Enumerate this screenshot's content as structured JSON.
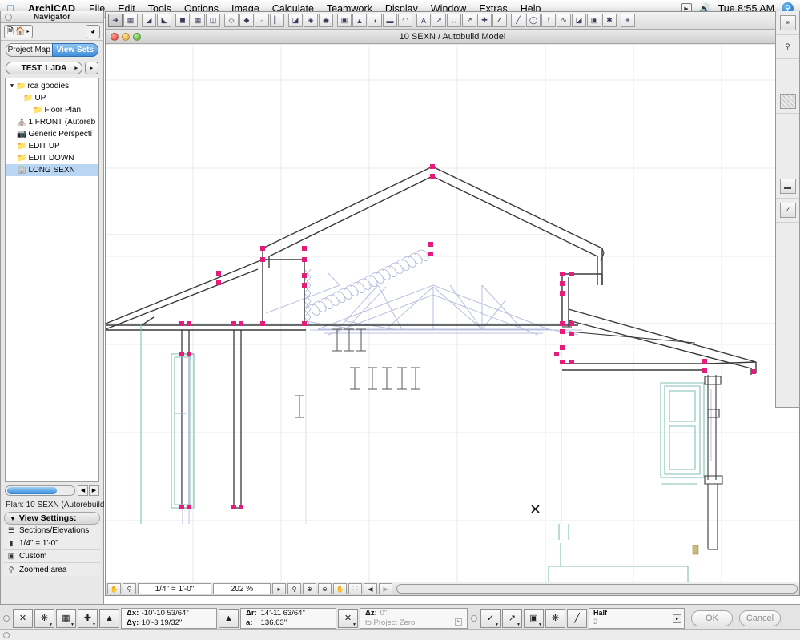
{
  "menubar": {
    "apple_icon": "apple-logo",
    "app_name": "ArchiCAD",
    "items": [
      "File",
      "Edit",
      "Tools",
      "Options",
      "Image",
      "Calculate",
      "Teamwork",
      "Display",
      "Window",
      "Extras",
      "Help"
    ],
    "status_icons": [
      "display-chevron-icon",
      "volume-icon"
    ],
    "clock": "Tue 8:55 AM",
    "spotlight_glyph": "search-icon"
  },
  "navigator": {
    "title": "Navigator",
    "toolbar": {
      "map_button": "project-map-button",
      "arrow": "▸",
      "right_button": "navigator-options-button"
    },
    "tabs": [
      {
        "label": "Project Map",
        "active": false
      },
      {
        "label": "View Sets",
        "active": true
      }
    ],
    "popup": {
      "value": "TEST 1 JDA",
      "arrow": "▸",
      "side_arrow": "▸"
    },
    "tree": [
      {
        "label": "rca goodies",
        "indent": 0,
        "twisty": "▼",
        "icon": "folder-icon",
        "selected": false
      },
      {
        "label": "UP",
        "indent": 1,
        "twisty": "",
        "icon": "folder-icon",
        "selected": false
      },
      {
        "label": "Floor Plan",
        "indent": 2,
        "twisty": "",
        "icon": "folder-icon",
        "selected": false
      },
      {
        "label": "1 FRONT (Autoreb",
        "indent": 0,
        "twisty": "",
        "icon": "elevation-icon",
        "selected": false
      },
      {
        "label": "Generic Perspecti",
        "indent": 0,
        "twisty": "",
        "icon": "perspective-icon",
        "selected": false
      },
      {
        "label": "EDIT UP",
        "indent": 0,
        "twisty": "",
        "icon": "folder-icon",
        "selected": false
      },
      {
        "label": "EDIT DOWN",
        "indent": 0,
        "twisty": "",
        "icon": "folder-icon",
        "selected": false
      },
      {
        "label": "LONG SEXN",
        "indent": 0,
        "twisty": "",
        "icon": "section-icon",
        "selected": true
      }
    ],
    "plan_line": "Plan: 10 SEXN (Autorebuild...",
    "view_settings": {
      "header": "View Settings:",
      "twisty": "▼",
      "rows": [
        {
          "icon": "layers-icon",
          "label": "Sections/Elevations"
        },
        {
          "icon": "scale-icon",
          "label": "1/4\"   =     1'-0\""
        },
        {
          "icon": "pen-icon",
          "label": "Custom"
        },
        {
          "icon": "zoom-icon",
          "label": "Zoomed area"
        }
      ]
    }
  },
  "document": {
    "title": "10 SEXN / Autobuild Model",
    "traffic_lights": [
      "close-button",
      "minimize-button",
      "zoom-button"
    ],
    "toolbar_icons": [
      "arrow-tool",
      "marquee-tool",
      "wall-tool",
      "beam-tool",
      "door-tool",
      "window-tool",
      "object-tool",
      "slab-tool",
      "roof-tool",
      "mesh-tool",
      "column-tool",
      "stair-tool",
      "lamp-tool",
      "zone-tool",
      "camera-tool",
      "light-tool",
      "section-tool",
      "elevation-tool",
      "detail-tool",
      "text-tool",
      "label-tool",
      "dimension-tool",
      "radial-dimension-tool",
      "level-dimension-tool",
      "angle-dimension-tool",
      "line-tool",
      "circle-tool",
      "arc-tool",
      "spline-tool",
      "fill-tool",
      "figure-tool",
      "hotspot-tool",
      "marker-tool"
    ],
    "scalebar": {
      "buttons_left": [
        "pan-hand-icon",
        "zoom-window-icon"
      ],
      "scale": "1/4\"  =   1'-0\"",
      "zoom_percent": "202 %",
      "popup_arrow": "▸",
      "buttons_right": [
        "zoom-fit-icon",
        "zoom-in-icon",
        "zoom-out-icon",
        "pan-icon",
        "fit-window-icon",
        "prev-zoom-icon",
        "next-zoom-icon"
      ]
    }
  },
  "right_palette": {
    "items": [
      "marker-button",
      "eyedropper-button",
      "fill-swatch-button",
      "pen-weight-button",
      "magic-wand-button"
    ]
  },
  "control_box": {
    "left_buttons": [
      "snap-toggle",
      "group-toggle",
      "grid-snap-toggle",
      "plus-tool",
      "delta-toggle"
    ],
    "coords": {
      "dx_label": "Δx:",
      "dx_value": "-10'-10 53/64\"",
      "dy_label": "Δy:",
      "dy_value": "10'-3 19/32\""
    },
    "polar": {
      "dr_label": "Δr:",
      "dr_value": "14'-11 63/64\"",
      "a_label": "a:",
      "a_value": "136.63\""
    },
    "z": {
      "dz_label": "Δz:",
      "dz_value": "0\"",
      "reference": "to Project Zero",
      "arrow": "▸"
    },
    "right_buttons": [
      "check-tool",
      "offset-tool",
      "magnet-tool",
      "wand-tool"
    ],
    "pen_popup": {
      "title": "Half",
      "value": "2",
      "arrow": "▸"
    },
    "ok_label": "OK",
    "cancel_label": "Cancel"
  },
  "drawing": {
    "name": "long-section-drawing",
    "colors": {
      "node": "#e61c7d",
      "structure": "#3a3a3a",
      "truss": "#b9bfe0",
      "openings": "#7fbfb5",
      "grid": "#e8e8e8",
      "guide": "#cfe6ef",
      "tan": "#bfae6a"
    },
    "grid": {
      "v_lines": [
        130,
        240,
        350,
        460,
        570,
        680,
        790,
        900
      ],
      "h_lines": [
        85,
        195,
        305,
        415,
        525,
        635
      ]
    }
  }
}
